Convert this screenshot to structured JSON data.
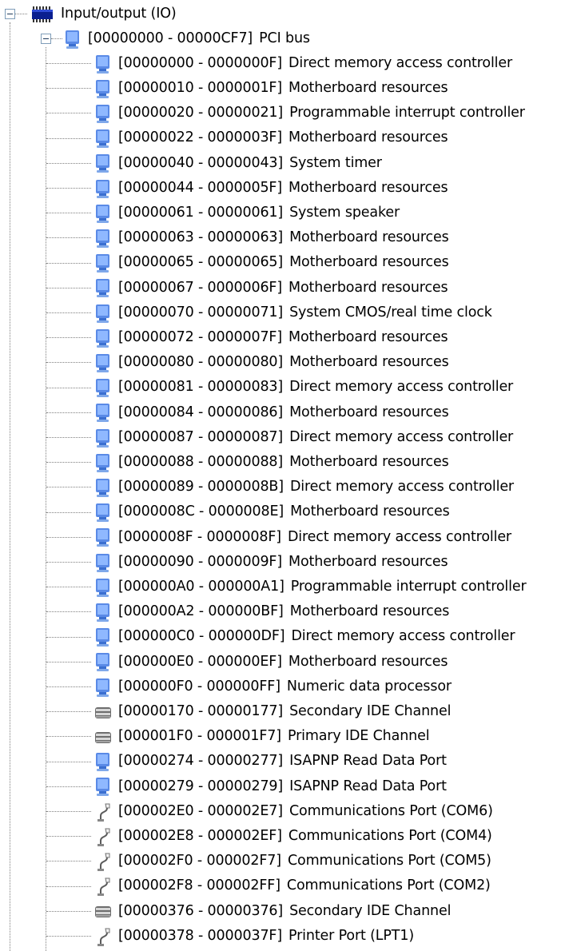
{
  "root": {
    "label": "Input/output (IO)",
    "icon": "io-chip-icon",
    "expanded": true
  },
  "pci_bus": {
    "range": "[00000000 - 00000CF7]",
    "name": "PCI bus",
    "icon": "pc-monitor-icon",
    "expanded": true
  },
  "items": [
    {
      "range": "[00000000 - 0000000F]",
      "name": "Direct memory access controller",
      "icon": "pc-monitor-icon"
    },
    {
      "range": "[00000010 - 0000001F]",
      "name": "Motherboard resources",
      "icon": "pc-monitor-icon"
    },
    {
      "range": "[00000020 - 00000021]",
      "name": "Programmable interrupt controller",
      "icon": "pc-monitor-icon"
    },
    {
      "range": "[00000022 - 0000003F]",
      "name": "Motherboard resources",
      "icon": "pc-monitor-icon"
    },
    {
      "range": "[00000040 - 00000043]",
      "name": "System timer",
      "icon": "pc-monitor-icon"
    },
    {
      "range": "[00000044 - 0000005F]",
      "name": "Motherboard resources",
      "icon": "pc-monitor-icon"
    },
    {
      "range": "[00000061 - 00000061]",
      "name": "System speaker",
      "icon": "pc-monitor-icon"
    },
    {
      "range": "[00000063 - 00000063]",
      "name": "Motherboard resources",
      "icon": "pc-monitor-icon"
    },
    {
      "range": "[00000065 - 00000065]",
      "name": "Motherboard resources",
      "icon": "pc-monitor-icon"
    },
    {
      "range": "[00000067 - 0000006F]",
      "name": "Motherboard resources",
      "icon": "pc-monitor-icon"
    },
    {
      "range": "[00000070 - 00000071]",
      "name": "System CMOS/real time clock",
      "icon": "pc-monitor-icon"
    },
    {
      "range": "[00000072 - 0000007F]",
      "name": "Motherboard resources",
      "icon": "pc-monitor-icon"
    },
    {
      "range": "[00000080 - 00000080]",
      "name": "Motherboard resources",
      "icon": "pc-monitor-icon"
    },
    {
      "range": "[00000081 - 00000083]",
      "name": "Direct memory access controller",
      "icon": "pc-monitor-icon"
    },
    {
      "range": "[00000084 - 00000086]",
      "name": "Motherboard resources",
      "icon": "pc-monitor-icon"
    },
    {
      "range": "[00000087 - 00000087]",
      "name": "Direct memory access controller",
      "icon": "pc-monitor-icon"
    },
    {
      "range": "[00000088 - 00000088]",
      "name": "Motherboard resources",
      "icon": "pc-monitor-icon"
    },
    {
      "range": "[00000089 - 0000008B]",
      "name": "Direct memory access controller",
      "icon": "pc-monitor-icon"
    },
    {
      "range": "[0000008C - 0000008E]",
      "name": "Motherboard resources",
      "icon": "pc-monitor-icon"
    },
    {
      "range": "[0000008F - 0000008F]",
      "name": "Direct memory access controller",
      "icon": "pc-monitor-icon"
    },
    {
      "range": "[00000090 - 0000009F]",
      "name": "Motherboard resources",
      "icon": "pc-monitor-icon"
    },
    {
      "range": "[000000A0 - 000000A1]",
      "name": "Programmable interrupt controller",
      "icon": "pc-monitor-icon"
    },
    {
      "range": "[000000A2 - 000000BF]",
      "name": "Motherboard resources",
      "icon": "pc-monitor-icon"
    },
    {
      "range": "[000000C0 - 000000DF]",
      "name": "Direct memory access controller",
      "icon": "pc-monitor-icon"
    },
    {
      "range": "[000000E0 - 000000EF]",
      "name": "Motherboard resources",
      "icon": "pc-monitor-icon"
    },
    {
      "range": "[000000F0 - 000000FF]",
      "name": "Numeric data processor",
      "icon": "pc-monitor-icon"
    },
    {
      "range": "[00000170 - 00000177]",
      "name": "Secondary IDE Channel",
      "icon": "ide-drive-icon"
    },
    {
      "range": "[000001F0 - 000001F7]",
      "name": "Primary IDE Channel",
      "icon": "ide-drive-icon"
    },
    {
      "range": "[00000274 - 00000277]",
      "name": "ISAPNP Read Data Port",
      "icon": "pc-monitor-icon"
    },
    {
      "range": "[00000279 - 00000279]",
      "name": "ISAPNP Read Data Port",
      "icon": "pc-monitor-icon"
    },
    {
      "range": "[000002E0 - 000002E7]",
      "name": "Communications Port (COM6)",
      "icon": "port-plug-icon"
    },
    {
      "range": "[000002E8 - 000002EF]",
      "name": "Communications Port (COM4)",
      "icon": "port-plug-icon"
    },
    {
      "range": "[000002F0 - 000002F7]",
      "name": "Communications Port (COM5)",
      "icon": "port-plug-icon"
    },
    {
      "range": "[000002F8 - 000002FF]",
      "name": "Communications Port (COM2)",
      "icon": "port-plug-icon"
    },
    {
      "range": "[00000376 - 00000376]",
      "name": "Secondary IDE Channel",
      "icon": "ide-drive-icon"
    },
    {
      "range": "[00000378 - 0000037F]",
      "name": "Printer Port (LPT1)",
      "icon": "port-plug-icon"
    }
  ]
}
